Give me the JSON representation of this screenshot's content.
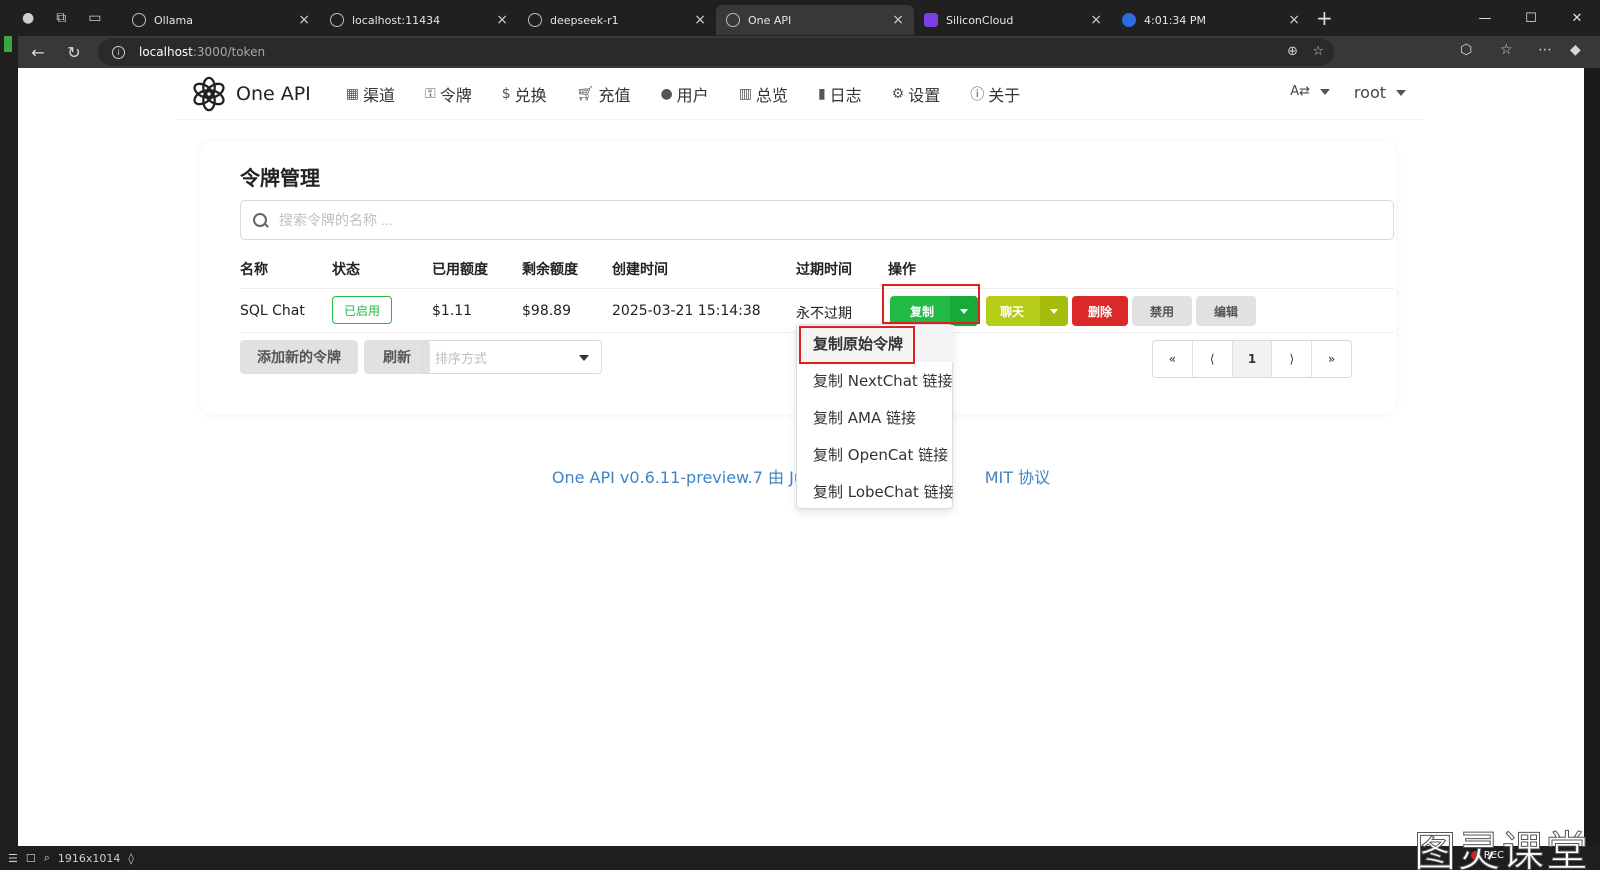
{
  "browser": {
    "tabs": [
      {
        "title": "Ollama",
        "active": false
      },
      {
        "title": "localhost:11434",
        "active": false
      },
      {
        "title": "deepseek-r1",
        "active": false
      },
      {
        "title": "One API",
        "active": true
      },
      {
        "title": "SiliconCloud",
        "active": false
      },
      {
        "title": "4:01:34 PM",
        "active": false
      }
    ],
    "address": {
      "host": "localhost",
      "path": ":3000/token"
    }
  },
  "app": {
    "name": "One API",
    "nav": [
      {
        "icon": "sitemap-icon",
        "label": "渠道"
      },
      {
        "icon": "key-icon",
        "label": "令牌"
      },
      {
        "icon": "dollar-icon",
        "label": "兑换"
      },
      {
        "icon": "cart-icon",
        "label": "充值"
      },
      {
        "icon": "user-icon",
        "label": "用户"
      },
      {
        "icon": "chart-icon",
        "label": "总览"
      },
      {
        "icon": "book-icon",
        "label": "日志"
      },
      {
        "icon": "gear-icon",
        "label": "设置"
      },
      {
        "icon": "info-icon",
        "label": "关于"
      }
    ],
    "user": "root"
  },
  "page": {
    "title": "令牌管理",
    "search_placeholder": "搜索令牌的名称 ...",
    "columns": [
      "名称",
      "状态",
      "已用额度",
      "剩余额度",
      "创建时间",
      "过期时间",
      "操作"
    ],
    "rows": [
      {
        "name": "SQL Chat",
        "status": "已启用",
        "used": "$1.11",
        "remaining": "$98.89",
        "created": "2025-03-21 15:14:38",
        "expires": "永不过期"
      }
    ],
    "actions": {
      "copy": "复制",
      "chat": "聊天",
      "delete": "删除",
      "disable": "禁用",
      "edit": "编辑"
    },
    "add_button": "添加新的令牌",
    "refresh_button": "刷新",
    "sort_placeholder": "排序方式",
    "pager": {
      "first": "«",
      "prev": "⟨",
      "current": "1",
      "next": "⟩",
      "last": "»"
    },
    "copy_menu": [
      "复制原始令牌",
      "复制 NextChat 链接",
      "复制 AMA 链接",
      "复制 OpenCat 链接",
      "复制 LobeChat 链接"
    ],
    "footer": "One API v0.6.11-preview.7 由 JustS",
    "footer_tail": "MIT 协议"
  },
  "statusbar": {
    "resolution": "1916x1014",
    "rec": "REC"
  },
  "watermark": "图灵课堂",
  "colors": {
    "green": "#21ba45",
    "olive": "#b5cc18",
    "red": "#db2828",
    "link": "#4183c4",
    "highlight": "#e02020"
  }
}
